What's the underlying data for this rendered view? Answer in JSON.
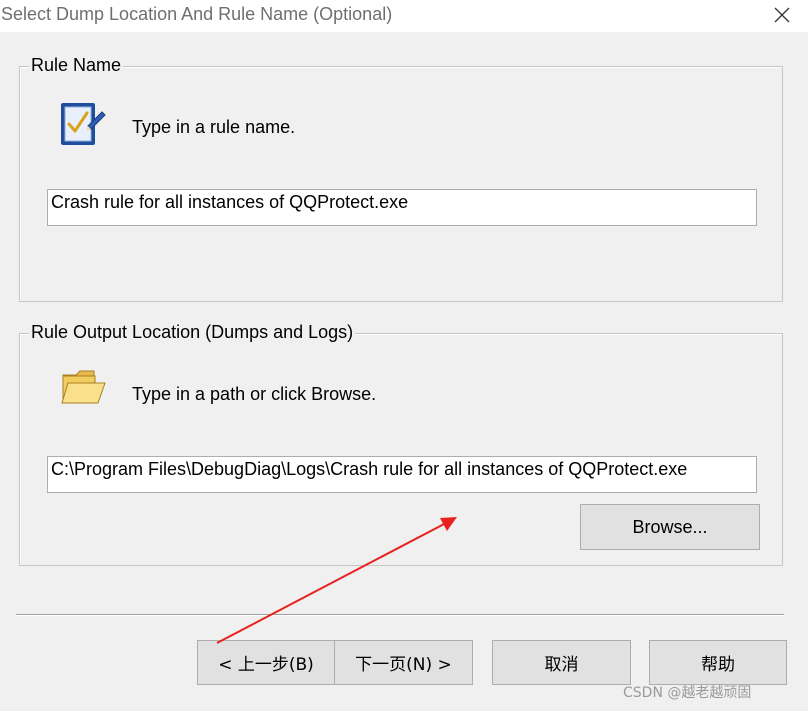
{
  "window": {
    "title": "Select Dump Location And Rule Name (Optional)",
    "close_icon": "close-icon"
  },
  "rule_name_group": {
    "legend": "Rule Name",
    "icon": "checklist-pen-icon",
    "hint": "Type in a rule name.",
    "value": "Crash rule for all instances of QQProtect.exe"
  },
  "output_group": {
    "legend": "Rule Output Location (Dumps and Logs)",
    "icon": "folder-icon",
    "hint": "Type in a path or click Browse.",
    "value": "C:\\Program Files\\DebugDiag\\Logs\\Crash rule for all instances of QQProtect.exe",
    "browse_label": "Browse..."
  },
  "footer": {
    "back_label": "< 上一步(B)",
    "next_label": "下一页(N) >",
    "cancel_label": "取消",
    "help_label": "帮助"
  },
  "annotation": {
    "color": "#e8231f"
  },
  "watermark": "CSDN @越老越顽固"
}
